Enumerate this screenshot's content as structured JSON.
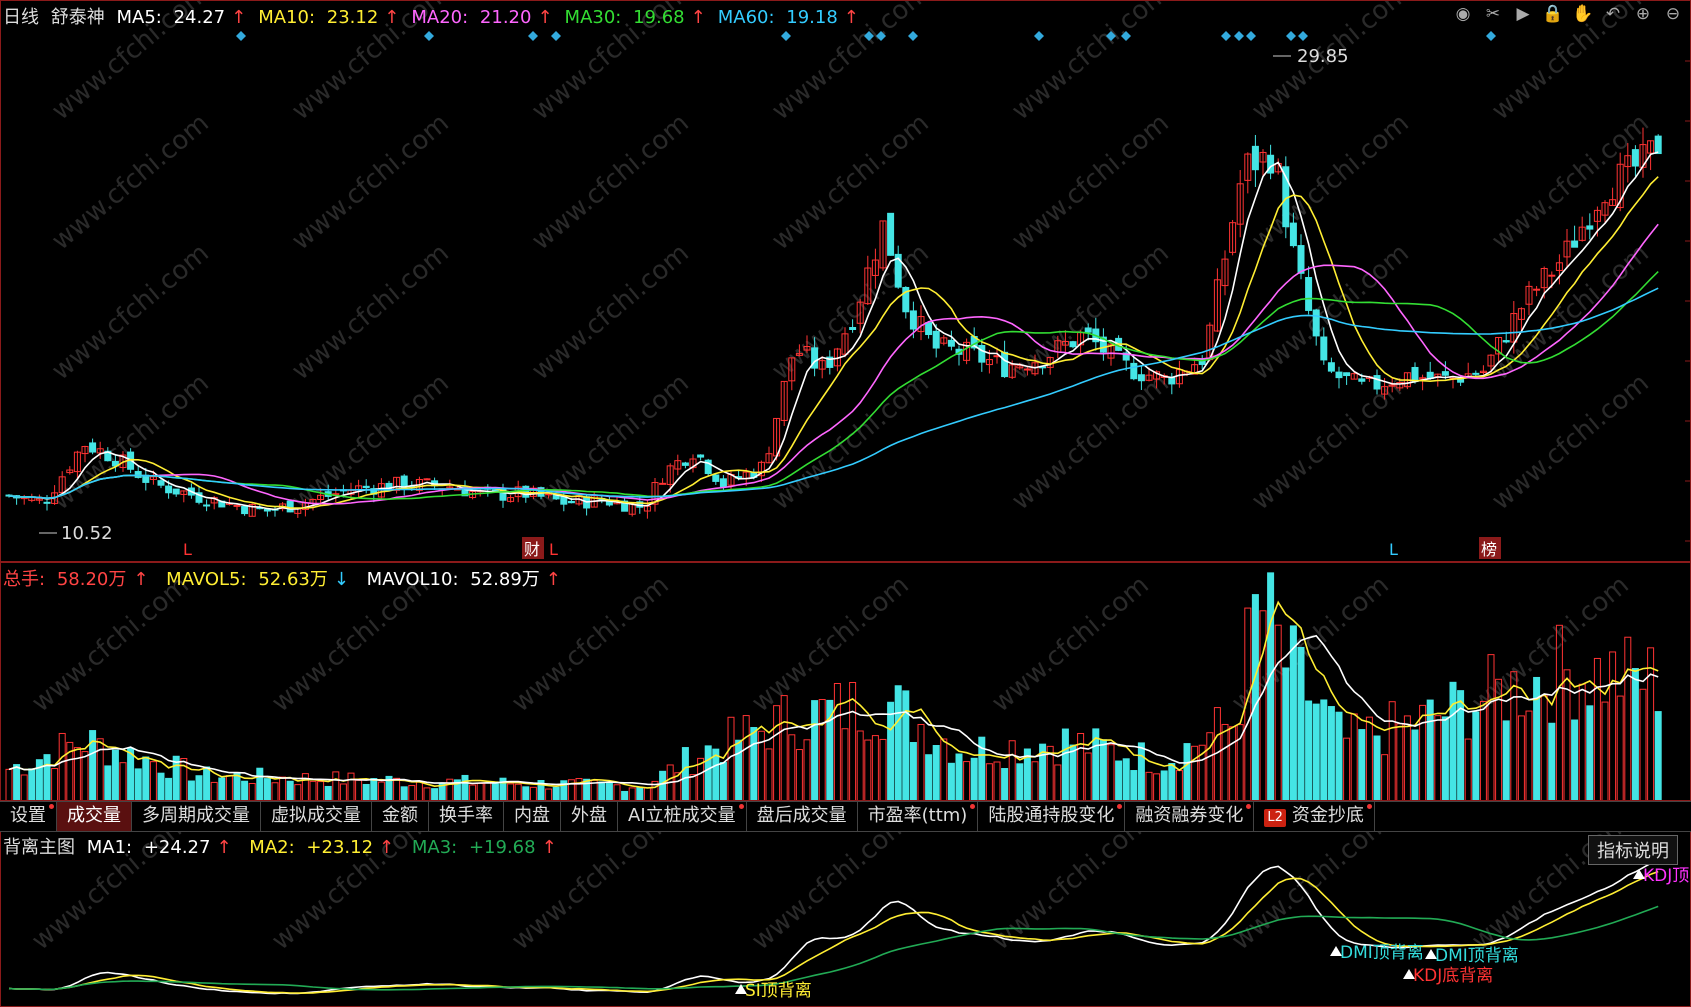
{
  "main": {
    "period": "日线",
    "stock_name": "舒泰神",
    "ma": [
      {
        "label": "MA5:",
        "value": "24.27",
        "color": "#ffffff",
        "arrow": "↑"
      },
      {
        "label": "MA10:",
        "value": "23.12",
        "color": "#ffee33",
        "arrow": "↑"
      },
      {
        "label": "MA20:",
        "value": "21.20",
        "color": "#ff66ff",
        "arrow": "↑"
      },
      {
        "label": "MA30:",
        "value": "19.68",
        "color": "#33dd33",
        "arrow": "↑"
      },
      {
        "label": "MA60:",
        "value": "19.18",
        "color": "#33ccff",
        "arrow": "↑"
      }
    ],
    "high_label": "29.85",
    "low_label": "10.52",
    "markers": {
      "l1": "L",
      "cai": "财",
      "l2": "L",
      "l3": "L",
      "bang": "榜"
    },
    "icons": [
      "eye-icon",
      "scissors-icon",
      "play-icon",
      "lock-icon",
      "hand-icon",
      "undo-icon",
      "plus-circle-icon",
      "minus-circle-icon"
    ]
  },
  "volume": {
    "total_label": "总手:",
    "total_value": "58.20万",
    "mavol5_label": "MAVOL5:",
    "mavol5_value": "52.63万",
    "mavol10_label": "MAVOL10:",
    "mavol10_value": "52.89万"
  },
  "tabs": [
    {
      "label": "设置",
      "dot": true
    },
    {
      "label": "成交量",
      "active": true
    },
    {
      "label": "多周期成交量"
    },
    {
      "label": "虚拟成交量"
    },
    {
      "label": "金额"
    },
    {
      "label": "换手率"
    },
    {
      "label": "内盘"
    },
    {
      "label": "外盘"
    },
    {
      "label": "AI立桩成交量",
      "dot": true
    },
    {
      "label": "盘后成交量"
    },
    {
      "label": "市盈率(ttm)",
      "dot": true
    },
    {
      "label": "陆股通持股变化",
      "dot": true
    },
    {
      "label": "融资融券变化",
      "dot": true
    },
    {
      "label": "资金抄底",
      "l2": "L2",
      "dot": true
    }
  ],
  "indicator": {
    "title": "背离主图",
    "ma1_label": "MA1:",
    "ma1_value": "+24.27",
    "ma2_label": "MA2:",
    "ma2_value": "+23.12",
    "ma3_label": "MA3:",
    "ma3_value": "+19.68",
    "help": "指标说明",
    "signals": {
      "s1": "SI顶背离",
      "s2": "DMI顶背离",
      "s3": "DMI顶背离",
      "s4": "KDJ底背离",
      "s5": "KDJ顶"
    }
  },
  "watermark": "www.cfchi.com"
}
